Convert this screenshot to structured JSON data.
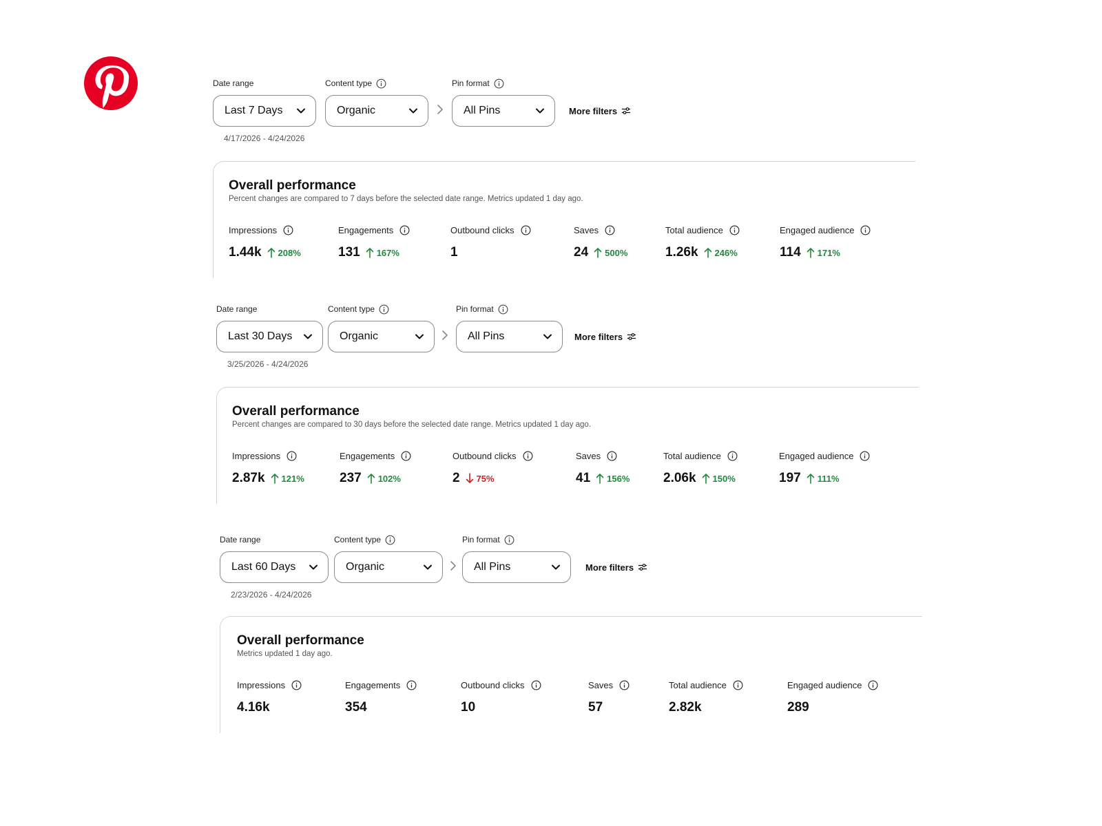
{
  "brand": {
    "logo_icon": "pinterest-logo",
    "logo_color": "#E60023"
  },
  "colors": {
    "positive": "#1f8a3b",
    "negative": "#cc1f1f",
    "border": "#8a8a8a"
  },
  "sections": [
    {
      "filters": {
        "date_range_label": "Date range",
        "date_range_value": "Last 7 Days",
        "content_type_label": "Content type",
        "content_type_value": "Organic",
        "pin_format_label": "Pin format",
        "pin_format_value": "All Pins",
        "more_filters_label": "More filters",
        "date_span": "4/17/2026 - 4/24/2026"
      },
      "card": {
        "title": "Overall performance",
        "subtitle": "Percent changes are compared to 7 days before the selected date range. Metrics updated 1 day ago.",
        "metrics": [
          {
            "label": "Impressions",
            "value": "1.44k",
            "change": "208%",
            "direction": "up"
          },
          {
            "label": "Engagements",
            "value": "131",
            "change": "167%",
            "direction": "up"
          },
          {
            "label": "Outbound clicks",
            "value": "1",
            "change": "",
            "direction": "none"
          },
          {
            "label": "Saves",
            "value": "24",
            "change": "500%",
            "direction": "up"
          },
          {
            "label": "Total audience",
            "value": "1.26k",
            "change": "246%",
            "direction": "up"
          },
          {
            "label": "Engaged audience",
            "value": "114",
            "change": "171%",
            "direction": "up"
          }
        ]
      }
    },
    {
      "filters": {
        "date_range_label": "Date range",
        "date_range_value": "Last 30 Days",
        "content_type_label": "Content type",
        "content_type_value": "Organic",
        "pin_format_label": "Pin format",
        "pin_format_value": "All Pins",
        "more_filters_label": "More filters",
        "date_span": "3/25/2026 - 4/24/2026"
      },
      "card": {
        "title": "Overall performance",
        "subtitle": "Percent changes are compared to 30 days before the selected date range. Metrics updated 1 day ago.",
        "metrics": [
          {
            "label": "Impressions",
            "value": "2.87k",
            "change": "121%",
            "direction": "up"
          },
          {
            "label": "Engagements",
            "value": "237",
            "change": "102%",
            "direction": "up"
          },
          {
            "label": "Outbound clicks",
            "value": "2",
            "change": "75%",
            "direction": "down"
          },
          {
            "label": "Saves",
            "value": "41",
            "change": "156%",
            "direction": "up"
          },
          {
            "label": "Total audience",
            "value": "2.06k",
            "change": "150%",
            "direction": "up"
          },
          {
            "label": "Engaged audience",
            "value": "197",
            "change": "111%",
            "direction": "up"
          }
        ]
      }
    },
    {
      "filters": {
        "date_range_label": "Date range",
        "date_range_value": "Last 60 Days",
        "content_type_label": "Content type",
        "content_type_value": "Organic",
        "pin_format_label": "Pin format",
        "pin_format_value": "All Pins",
        "more_filters_label": "More filters",
        "date_span": "2/23/2026 - 4/24/2026"
      },
      "card": {
        "title": "Overall performance",
        "subtitle": "Metrics updated 1 day ago.",
        "metrics": [
          {
            "label": "Impressions",
            "value": "4.16k",
            "change": "",
            "direction": "none"
          },
          {
            "label": "Engagements",
            "value": "354",
            "change": "",
            "direction": "none"
          },
          {
            "label": "Outbound clicks",
            "value": "10",
            "change": "",
            "direction": "none"
          },
          {
            "label": "Saves",
            "value": "57",
            "change": "",
            "direction": "none"
          },
          {
            "label": "Total audience",
            "value": "2.82k",
            "change": "",
            "direction": "none"
          },
          {
            "label": "Engaged audience",
            "value": "289",
            "change": "",
            "direction": "none"
          }
        ]
      }
    }
  ]
}
